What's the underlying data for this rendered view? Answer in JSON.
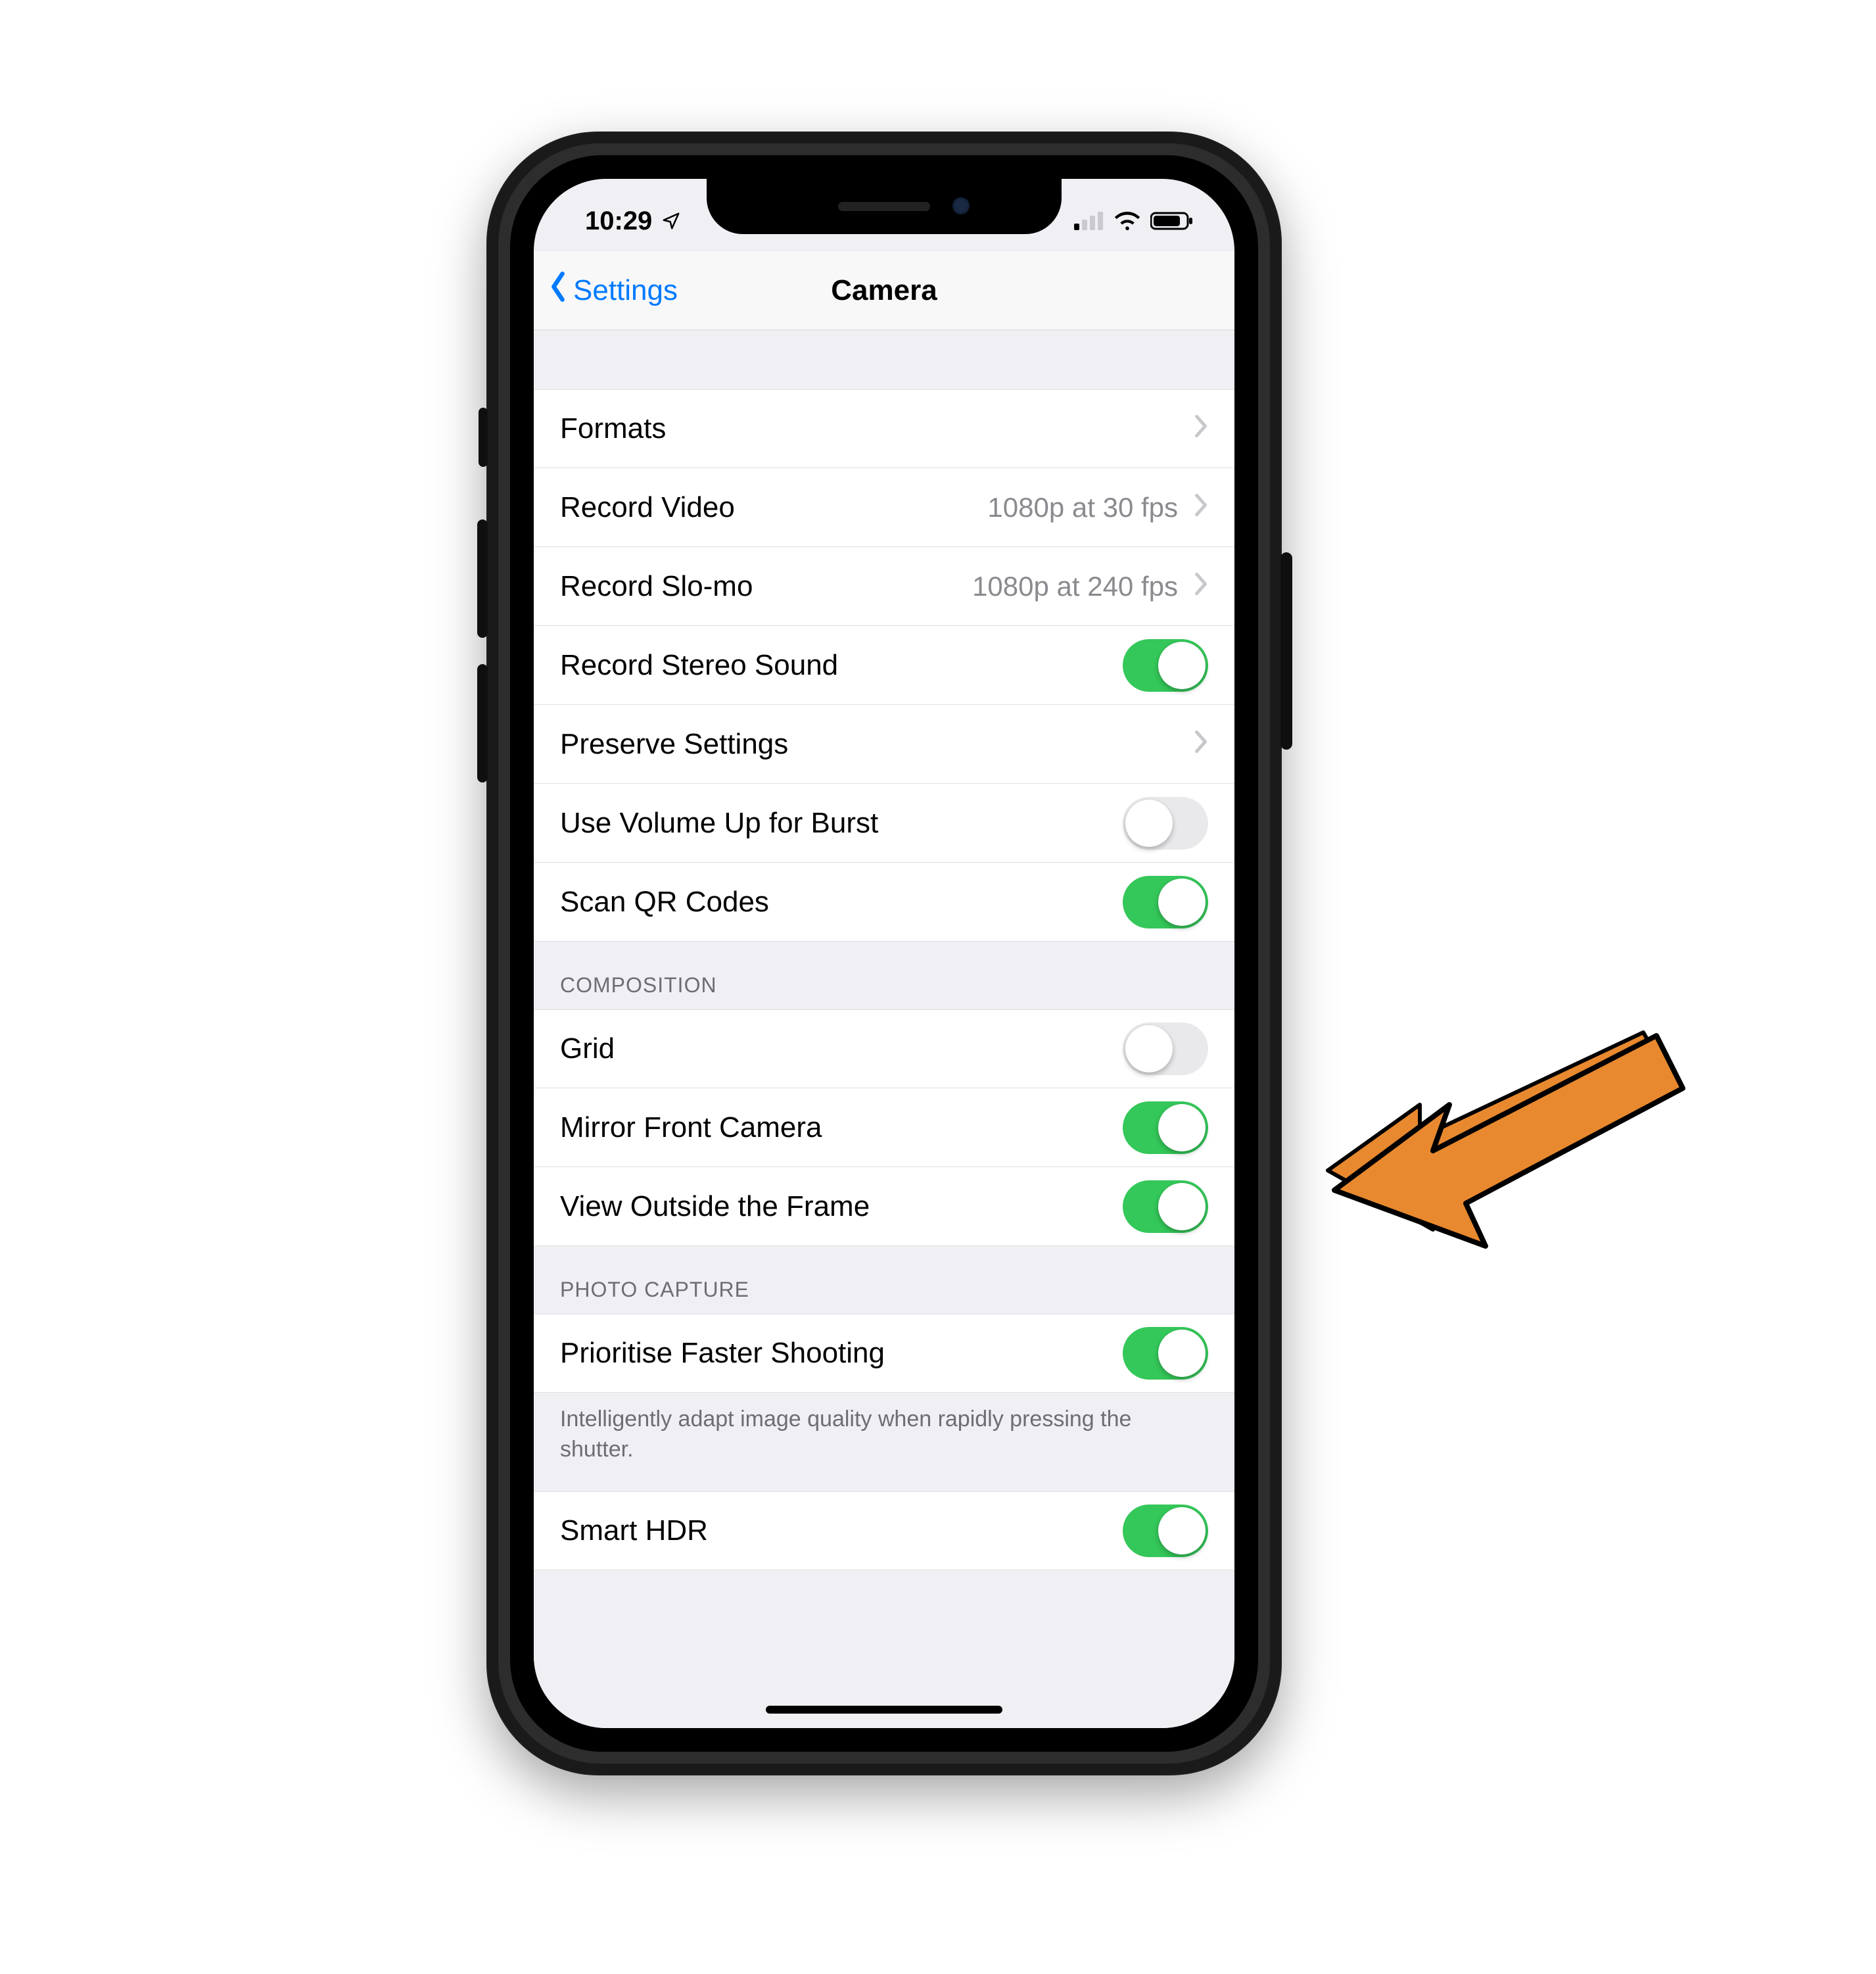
{
  "statusbar": {
    "time": "10:29",
    "location_icon": "location-arrow",
    "signal_bars": 1,
    "wifi": true,
    "battery_pct": 80
  },
  "nav": {
    "back_label": "Settings",
    "title": "Camera"
  },
  "sections": [
    {
      "header": "",
      "rows": [
        {
          "label": "Formats",
          "type": "disclosure",
          "value": ""
        },
        {
          "label": "Record Video",
          "type": "disclosure",
          "value": "1080p at 30 fps"
        },
        {
          "label": "Record Slo-mo",
          "type": "disclosure",
          "value": "1080p at 240 fps"
        },
        {
          "label": "Record Stereo Sound",
          "type": "switch",
          "on": true
        },
        {
          "label": "Preserve Settings",
          "type": "disclosure",
          "value": ""
        },
        {
          "label": "Use Volume Up for Burst",
          "type": "switch",
          "on": false
        },
        {
          "label": "Scan QR Codes",
          "type": "switch",
          "on": true
        }
      ]
    },
    {
      "header": "COMPOSITION",
      "rows": [
        {
          "label": "Grid",
          "type": "switch",
          "on": false
        },
        {
          "label": "Mirror Front Camera",
          "type": "switch",
          "on": true
        },
        {
          "label": "View Outside the Frame",
          "type": "switch",
          "on": true
        }
      ]
    },
    {
      "header": "PHOTO CAPTURE",
      "rows": [
        {
          "label": "Prioritise Faster Shooting",
          "type": "switch",
          "on": true
        }
      ],
      "footer": "Intelligently adapt image quality when rapidly pressing the shutter."
    },
    {
      "header": "",
      "rows": [
        {
          "label": "Smart HDR",
          "type": "switch",
          "on": true
        }
      ]
    }
  ],
  "annotation": {
    "points_to": "Mirror Front Camera",
    "color": "#e8892f"
  }
}
